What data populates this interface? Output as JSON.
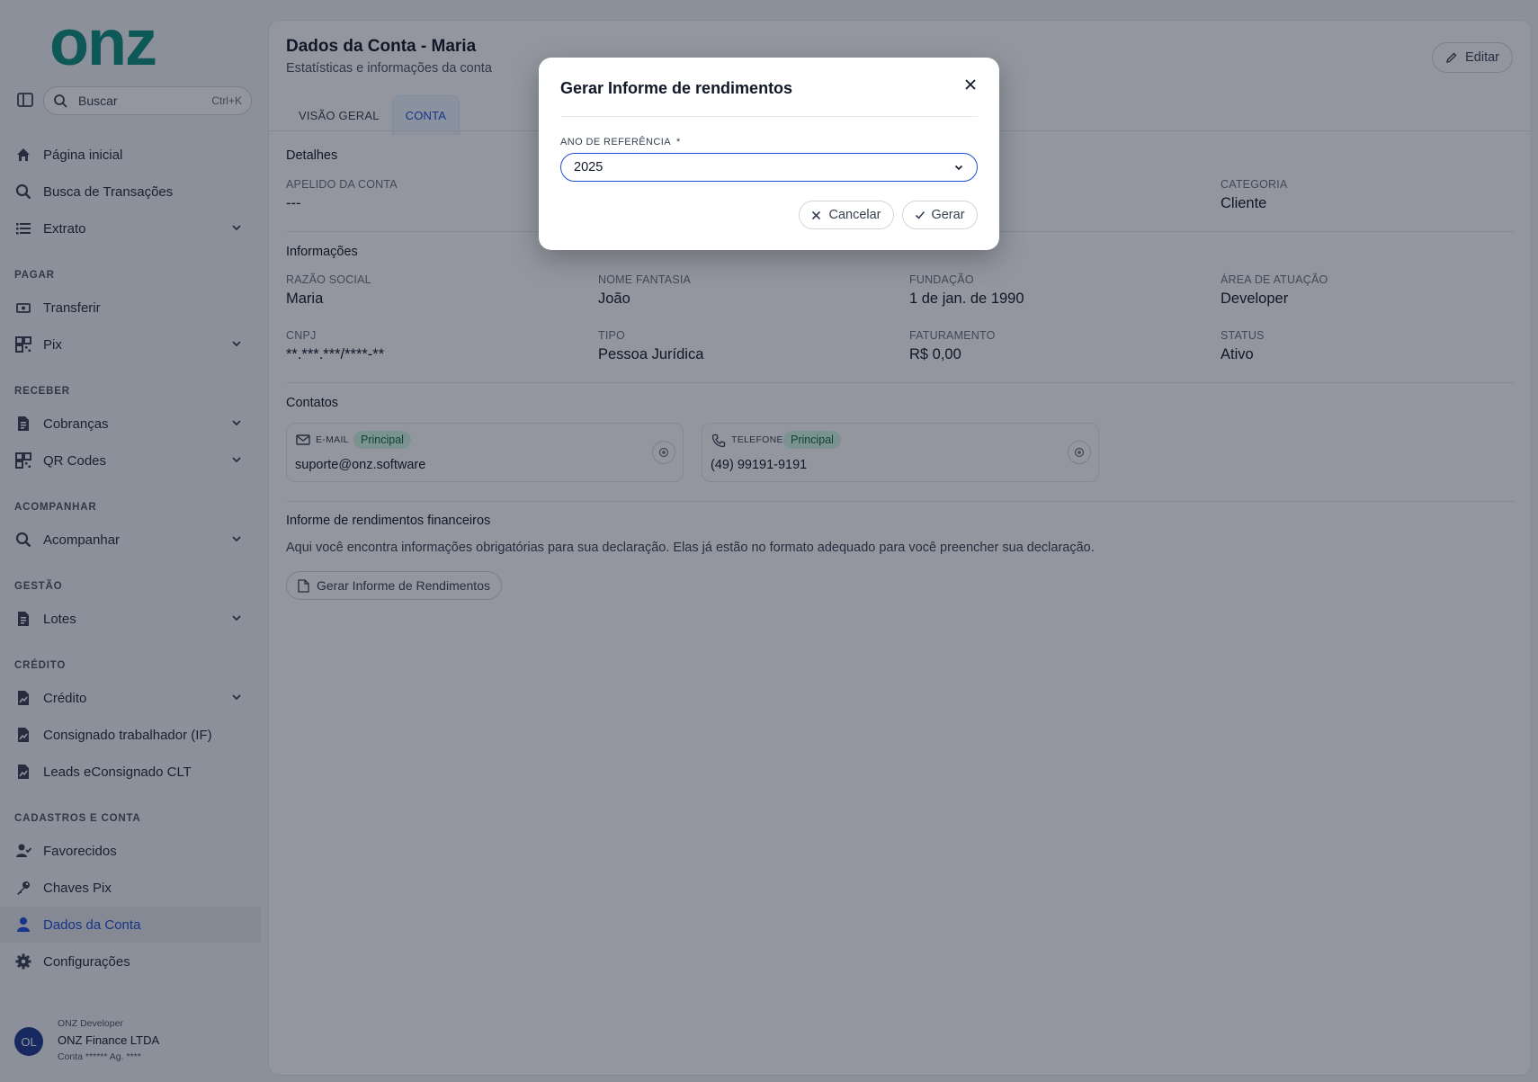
{
  "brand": {
    "logo_text": "onz",
    "color": "#0f8f7e"
  },
  "sidebar": {
    "search": {
      "label": "Buscar",
      "shortcut": "Ctrl+K"
    },
    "items": [
      {
        "label": "Página inicial",
        "icon": "home-icon"
      },
      {
        "label": "Busca de Transações",
        "icon": "search-icon"
      },
      {
        "label": "Extrato",
        "icon": "list-icon",
        "expandable": true
      }
    ],
    "sections": [
      {
        "title": "PAGAR",
        "items": [
          {
            "label": "Transferir",
            "icon": "transfer-icon"
          },
          {
            "label": "Pix",
            "icon": "grid-icon",
            "expandable": true
          }
        ]
      },
      {
        "title": "RECEBER",
        "items": [
          {
            "label": "Cobranças",
            "icon": "document-icon",
            "expandable": true
          },
          {
            "label": "QR Codes",
            "icon": "qrcode-icon",
            "expandable": true
          }
        ]
      },
      {
        "title": "ACOMPANHAR",
        "items": [
          {
            "label": "Acompanhar",
            "icon": "search-icon",
            "expandable": true
          }
        ]
      },
      {
        "title": "GESTÃO",
        "items": [
          {
            "label": "Lotes",
            "icon": "document-icon",
            "expandable": true
          }
        ]
      },
      {
        "title": "CRÉDITO",
        "items": [
          {
            "label": "Crédito",
            "icon": "chart-doc-icon",
            "expandable": true
          },
          {
            "label": "Consignado trabalhador (IF)",
            "icon": "chart-doc-icon"
          },
          {
            "label": "Leads eConsignado CLT",
            "icon": "chart-doc-icon"
          }
        ]
      },
      {
        "title": "CADASTROS E CONTA",
        "items": [
          {
            "label": "Favorecidos",
            "icon": "user-check-icon"
          },
          {
            "label": "Chaves Pix",
            "icon": "key-icon"
          },
          {
            "label": "Dados da Conta",
            "icon": "user-icon",
            "active": true
          },
          {
            "label": "Configurações",
            "icon": "gear-icon"
          }
        ]
      }
    ],
    "user": {
      "initials": "OL",
      "role": "ONZ Developer",
      "company": "ONZ Finance LTDA",
      "account": "Conta ****** Ag. ****"
    }
  },
  "main": {
    "title": "Dados da Conta - Maria",
    "subtitle": "Estatísticas e informações da conta",
    "edit_label": "Editar",
    "tabs": [
      {
        "label": "VISÃO GERAL",
        "active": false
      },
      {
        "label": "CONTA",
        "active": true
      }
    ],
    "detalhes": {
      "title": "Detalhes",
      "apelido_label": "APELIDO DA CONTA",
      "apelido_value": "---",
      "categoria_label": "CATEGORIA",
      "categoria_value": "Cliente"
    },
    "informacoes": {
      "title": "Informações",
      "fields": [
        {
          "label": "RAZÃO SOCIAL",
          "value": "Maria"
        },
        {
          "label": "NOME FANTASIA",
          "value": "João"
        },
        {
          "label": "FUNDAÇÃO",
          "value": "1 de jan. de 1990"
        },
        {
          "label": "ÁREA DE ATUAÇÃO",
          "value": "Developer"
        },
        {
          "label": "CNPJ",
          "value": "**.***.***/****-**"
        },
        {
          "label": "TIPO",
          "value": "Pessoa Jurídica"
        },
        {
          "label": "FATURAMENTO",
          "value": "R$ 0,00"
        },
        {
          "label": "STATUS",
          "value": "Ativo"
        }
      ]
    },
    "contatos": {
      "title": "Contatos",
      "cards": [
        {
          "type": "E-MAIL",
          "badge": "Principal",
          "value": "suporte@onz.software",
          "icon": "mail-icon"
        },
        {
          "type": "TELEFONE",
          "badge": "Principal",
          "value": "(49) 99191-9191",
          "icon": "phone-icon"
        }
      ]
    },
    "informe": {
      "title": "Informe de rendimentos financeiros",
      "description": "Aqui você encontra informações obrigatórias para sua declaração. Elas já estão no formato adequado para você preencher sua declaração.",
      "button_label": "Gerar Informe de Rendimentos"
    }
  },
  "modal": {
    "title": "Gerar Informe de rendimentos",
    "field_label": "ANO DE REFERÊNCIA",
    "required_mark": "*",
    "selected_year": "2025",
    "cancel_label": "Cancelar",
    "confirm_label": "Gerar"
  },
  "colors": {
    "accent": "#1d4ed8",
    "badge_bg": "#d1fae5",
    "badge_text": "#166534",
    "overlay": "rgba(15,23,42,0.45)"
  }
}
